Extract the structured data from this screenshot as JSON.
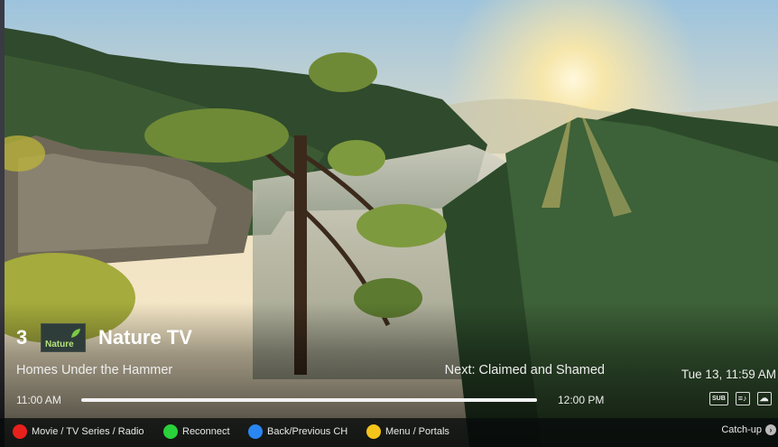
{
  "channel": {
    "number": "3",
    "logo_text": "Nature",
    "name": "Nature TV"
  },
  "program": {
    "current_title": "Homes Under the Hammer",
    "next_label": "Next: Claimed and Shamed",
    "start_time": "11:00 AM",
    "end_time": "12:00 PM",
    "progress_fraction": 1.0
  },
  "clock": "Tue 13, 11:59 AM",
  "status_icons": [
    {
      "name": "subtitles-icon",
      "text": "SUB"
    },
    {
      "name": "audio-track-icon",
      "text": "≡♪"
    },
    {
      "name": "cloud-icon",
      "text": "☁"
    }
  ],
  "legend": {
    "red": {
      "label": "Movie / TV Series / Radio",
      "color": "#e8201c"
    },
    "green": {
      "label": "Reconnect",
      "color": "#29d13b"
    },
    "blue": {
      "label": "Back/Previous CH",
      "color": "#2a86f0"
    },
    "yellow": {
      "label": "Menu / Portals",
      "color": "#f5c41a"
    }
  },
  "catchup": {
    "label": "Catch-up"
  }
}
